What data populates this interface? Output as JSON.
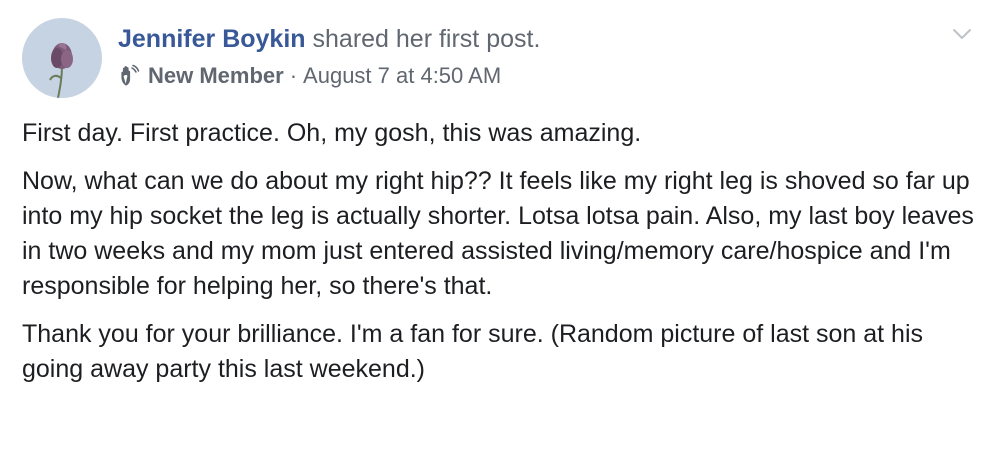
{
  "post": {
    "author": "Jennifer Boykin",
    "action": " shared her first post.",
    "badge_icon": "waving-hand-icon",
    "badge_label": "New Member",
    "separator": "·",
    "timestamp": "August 7 at 4:50 AM",
    "menu_icon": "chevron-down-icon",
    "paragraphs": [
      "First day. First practice. Oh, my gosh, this was amazing.",
      "Now, what can we do about my right hip?? It feels like my right leg is shoved so far up into my hip socket the leg is actually shorter. Lotsa lotsa pain. Also, my last boy leaves in two weeks and my mom just entered assisted living/memory care/hospice and I'm responsible for helping her, so there's that.",
      "Thank you for your brilliance. I'm a fan for sure. (Random picture of last son at his going away party this last weekend.)"
    ]
  },
  "colors": {
    "author": "#385898",
    "meta": "#606770",
    "text": "#1c1e21",
    "avatar_bg": "#c6d3e2"
  }
}
